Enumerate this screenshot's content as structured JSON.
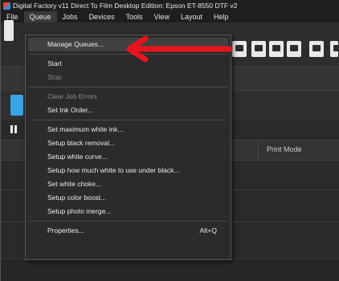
{
  "window": {
    "title": "Digital Factory v11 Direct To Film Desktop Edition: Epson ET-8550 DTF v2"
  },
  "menubar": {
    "items": [
      "File",
      "Queue",
      "Jobs",
      "Devices",
      "Tools",
      "View",
      "Layout",
      "Help"
    ],
    "active": "Queue"
  },
  "queue_menu": {
    "manage_queues": "Manage Queues...",
    "start": "Start",
    "stop": "Stop",
    "clear_job_errors": "Clear Job Errors",
    "set_ink_order": "Set Ink Order...",
    "set_max_white_ink": "Set maximum white ink...",
    "setup_black_removal": "Setup black removal...",
    "setup_white_curve": "Setup white curve...",
    "setup_white_under_black": "Setup how much white to use under black...",
    "set_white_choke": "Set white choke...",
    "setup_color_boost": "Setup color boost...",
    "setup_photo_merge": "Setup photo merge...",
    "properties": "Properties...",
    "properties_shortcut": "Alt+Q"
  },
  "table": {
    "print_mode_header": "Print Mode"
  },
  "colors": {
    "annotation_arrow": "#e8141c",
    "accent_blue": "#3aa3e8",
    "background": "#2a2a2a"
  }
}
